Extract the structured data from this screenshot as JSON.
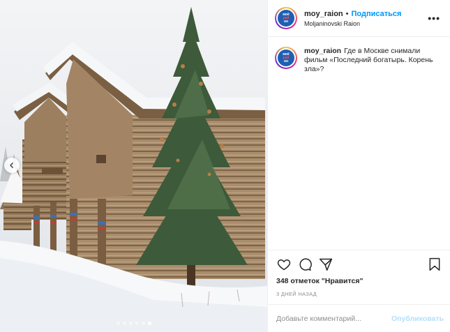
{
  "post": {
    "username": "moy_raion",
    "follow_label": "Подписаться",
    "bullet": "•",
    "location": "Moljaninovski Raion",
    "more_label": "•••",
    "avatar": {
      "line1": "моё",
      "line2": "рай",
      "line3": "он"
    }
  },
  "caption": {
    "username": "moy_raion",
    "text": "Где в Москве снимали фильм «Последний богатырь. Корень зла»?"
  },
  "photo": {
    "description_icon": "wooden-houses-snow-spruce",
    "carousel": {
      "total": 6,
      "active": 5
    }
  },
  "actions": {
    "likes": "348 отметок \"Нравится\"",
    "time": "3 ДНЕЙ НАЗАД"
  },
  "comment_box": {
    "placeholder": "Добавьте комментарий...",
    "publish_label": "Опубликовать"
  },
  "colors": {
    "link": "#0095f6",
    "publish_disabled": "#b2dffc",
    "muted": "#8e8e8e"
  }
}
